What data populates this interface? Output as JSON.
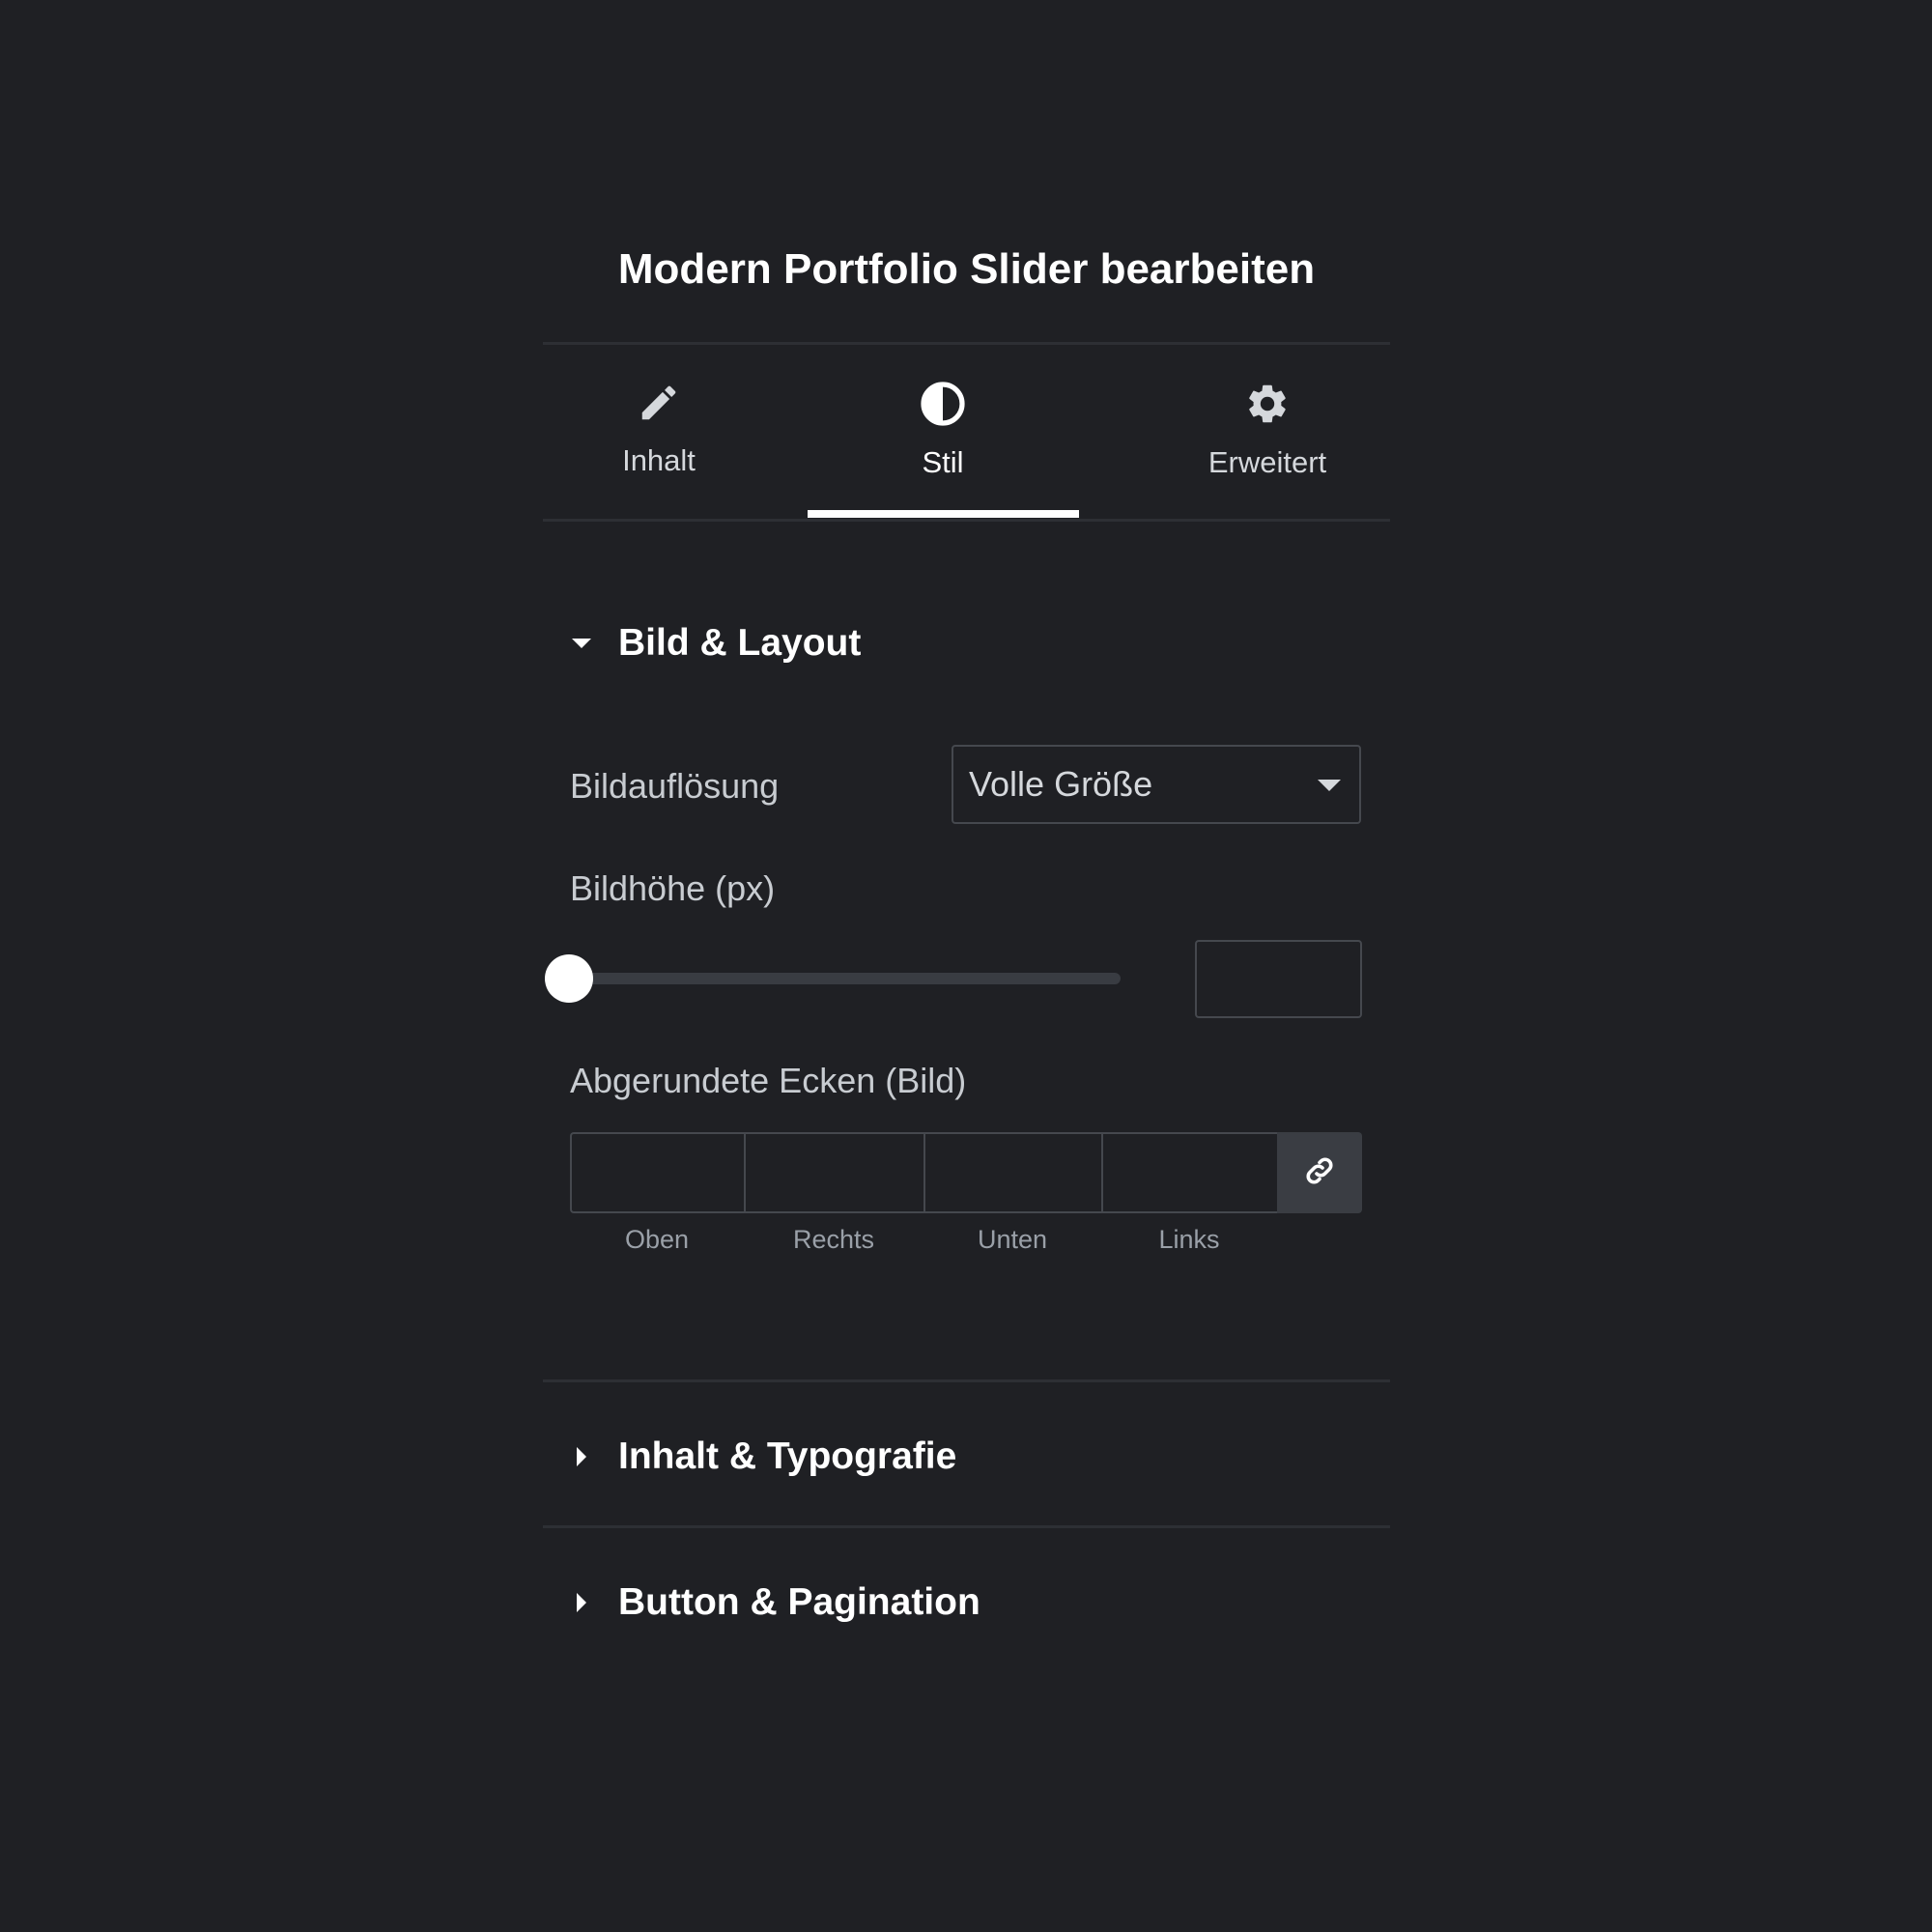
{
  "panel": {
    "title": "Modern Portfolio Slider bearbeiten"
  },
  "tabs": [
    {
      "label": "Inhalt",
      "icon": "pencil-icon",
      "active": false
    },
    {
      "label": "Stil",
      "icon": "contrast-icon",
      "active": true
    },
    {
      "label": "Erweitert",
      "icon": "gear-icon",
      "active": false
    }
  ],
  "sections": [
    {
      "title": "Bild & Layout",
      "expanded": true
    },
    {
      "title": "Inhalt & Typografie",
      "expanded": false
    },
    {
      "title": "Button & Pagination",
      "expanded": false
    }
  ],
  "controls": {
    "resolution": {
      "label": "Bildauflösung",
      "value": "Volle Größe"
    },
    "height": {
      "label": "Bildhöhe (px)",
      "value": "",
      "slider_level": 0
    },
    "radius": {
      "label": "Abgerundete Ecken (Bild)",
      "fields": [
        "Oben",
        "Rechts",
        "Unten",
        "Links"
      ],
      "values": [
        "",
        "",
        "",
        ""
      ],
      "linked_icon": "link-icon"
    }
  },
  "colors": {
    "background": "#1f2024",
    "border": "#45484e",
    "accent": "#ffffff"
  }
}
